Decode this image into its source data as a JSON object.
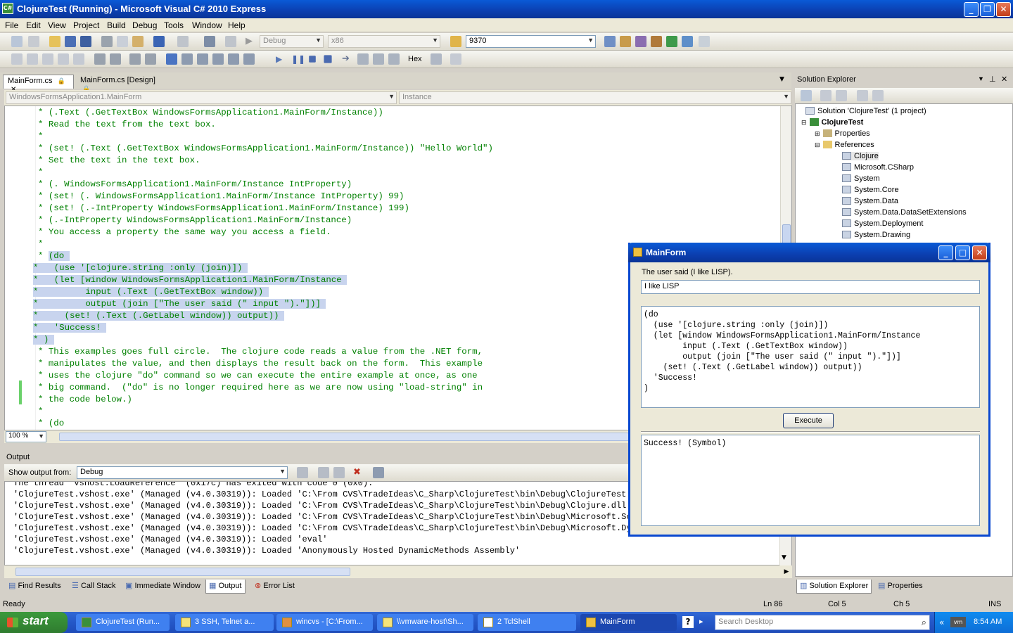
{
  "window": {
    "title": "ClojureTest (Running) - Microsoft Visual C# 2010 Express",
    "icon_label": "C#"
  },
  "menu": [
    "File",
    "Edit",
    "View",
    "Project",
    "Build",
    "Debug",
    "Tools",
    "Window",
    "Help"
  ],
  "toolbar": {
    "config": "Debug",
    "platform": "x86",
    "process": "9370",
    "hex_label": "Hex"
  },
  "editor": {
    "tabs": [
      {
        "label": "MainForm.cs"
      },
      {
        "label": "MainForm.cs [Design]"
      }
    ],
    "nav_class": "WindowsFormsApplication1.MainForm",
    "nav_member": "Instance",
    "zoom": "100 %",
    "lines": [
      {
        "text": "* (.Text (.GetTextBox WindowsFormsApplication1.MainForm/Instance))",
        "sel": ""
      },
      {
        "text": "* Read the text from the text box.",
        "sel": ""
      },
      {
        "text": "*",
        "sel": ""
      },
      {
        "text": "* (set! (.Text (.GetTextBox WindowsFormsApplication1.MainForm/Instance)) \"Hello World\")",
        "sel": ""
      },
      {
        "text": "* Set the text in the text box.",
        "sel": ""
      },
      {
        "text": "*",
        "sel": ""
      },
      {
        "text": "* (. WindowsFormsApplication1.MainForm/Instance IntProperty)",
        "sel": ""
      },
      {
        "text": "* (set! (. WindowsFormsApplication1.MainForm/Instance IntProperty) 99)",
        "sel": ""
      },
      {
        "text": "* (set! (.-IntProperty WindowsFormsApplication1.MainForm/Instance) 199)",
        "sel": ""
      },
      {
        "text": "* (.-IntProperty WindowsFormsApplication1.MainForm/Instance)",
        "sel": ""
      },
      {
        "text": "* You access a property the same way you access a field.",
        "sel": ""
      },
      {
        "text": "*",
        "sel": ""
      },
      {
        "text": "* ",
        "sel": "(do "
      },
      {
        "text": "",
        "sel": "*   (use '[clojure.string :only (join)]) "
      },
      {
        "text": "",
        "sel": "*   (let [window WindowsFormsApplication1.MainForm/Instance "
      },
      {
        "text": "",
        "sel": "*         input (.Text (.GetTextBox window)) "
      },
      {
        "text": "",
        "sel": "*         output (join [\"The user said (\" input \").\"])] "
      },
      {
        "text": "",
        "sel": "*     (set! (.Text (.GetLabel window)) output)) "
      },
      {
        "text": "",
        "sel": "*   'Success! "
      },
      {
        "text": "",
        "sel": "* ) "
      },
      {
        "text": "* This examples goes full circle.  The clojure code reads a value from the .NET form,",
        "sel": ""
      },
      {
        "text": "* manipulates the value, and then displays the result back on the form.  This example",
        "sel": ""
      },
      {
        "text": "* uses the clojure \"do\" command so we can execute the entire example at once, as one",
        "sel": ""
      },
      {
        "text": "* big command.  (\"do\" is no longer required here as we are now using \"load-string\" in",
        "sel": ""
      },
      {
        "text": "* the code below.)",
        "sel": ""
      },
      {
        "text": "*",
        "sel": ""
      },
      {
        "text": "* (do",
        "sel": ""
      }
    ]
  },
  "output": {
    "title": "Output",
    "show_from_label": "Show output from:",
    "show_from_value": "Debug",
    "lines": [
      "The thread 'vshost.LoadReference' (0x17c) has exited with code 0 (0x0).",
      "'ClojureTest.vshost.exe' (Managed (v4.0.30319)): Loaded 'C:\\From CVS\\TradeIdeas\\C_Sharp\\ClojureTest\\bin\\Debug\\ClojureTest.exe'",
      "'ClojureTest.vshost.exe' (Managed (v4.0.30319)): Loaded 'C:\\From CVS\\TradeIdeas\\C_Sharp\\ClojureTest\\bin\\Debug\\Clojure.dll'",
      "'ClojureTest.vshost.exe' (Managed (v4.0.30319)): Loaded 'C:\\From CVS\\TradeIdeas\\C_Sharp\\ClojureTest\\bin\\Debug\\Microsoft.Scripting",
      "'ClojureTest.vshost.exe' (Managed (v4.0.30319)): Loaded 'C:\\From CVS\\TradeIdeas\\C_Sharp\\ClojureTest\\bin\\Debug\\Microsoft.Dynamic",
      "'ClojureTest.vshost.exe' (Managed (v4.0.30319)): Loaded 'eval'",
      "'ClojureTest.vshost.exe' (Managed (v4.0.30319)): Loaded 'Anonymously Hosted DynamicMethods Assembly'"
    ]
  },
  "bottom_tabs": [
    "Find Results",
    "Call Stack",
    "Immediate Window",
    "Output",
    "Error List"
  ],
  "solution_explorer": {
    "title": "Solution Explorer",
    "solution": "Solution 'ClojureTest' (1 project)",
    "project": "ClojureTest",
    "properties": "Properties",
    "references": "References",
    "refs": [
      "Clojure",
      "Microsoft.CSharp",
      "System",
      "System.Core",
      "System.Data",
      "System.Data.DataSetExtensions",
      "System.Deployment",
      "System.Drawing"
    ],
    "tabs": [
      "Solution Explorer",
      "Properties"
    ]
  },
  "mainform": {
    "title": "MainForm",
    "label": "The user said (I like LISP).",
    "input": "I like LISP",
    "code": "(do\n  (use '[clojure.string :only (join)])\n  (let [window WindowsFormsApplication1.MainForm/Instance\n        input (.Text (.GetTextBox window))\n        output (join [\"The user said (\" input \").\"])]\n    (set! (.Text (.GetLabel window)) output))\n  'Success!\n)",
    "execute_label": "Execute",
    "result": "Success! (Symbol)"
  },
  "status": {
    "ready": "Ready",
    "ln": "Ln 86",
    "col": "Col 5",
    "ch": "Ch 5",
    "ins": "INS"
  },
  "taskbar": {
    "start": "start",
    "tasks": [
      "ClojureTest (Run...",
      "3 SSH, Telnet a...",
      "wincvs - [C:\\From...",
      "\\\\vmware-host\\Sh...",
      "2 TclShell",
      "MainForm"
    ],
    "search_placeholder": "Search Desktop",
    "clock": "8:54 AM"
  },
  "colors": {
    "titlebar": "#0b3fb0",
    "code_green": "#008000",
    "selection": "#c8d4ee",
    "taskbar": "#2457c8",
    "start_green": "#3c9a3c"
  }
}
